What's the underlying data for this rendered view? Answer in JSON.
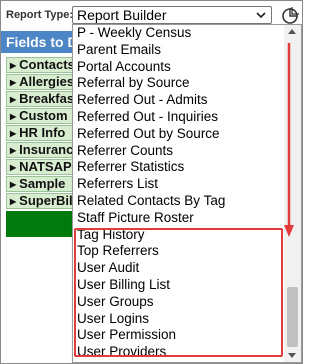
{
  "toolbar": {
    "report_type_label": "Report Type:",
    "report_type_value": "Report Builder"
  },
  "fields_header": "Fields to Display",
  "background_items": [
    "Contacts",
    "Allergies",
    "Breakfast",
    "Custom",
    "HR Info",
    "Insurance",
    "NATSAP",
    "Sample",
    "SuperBill"
  ],
  "dropdown": {
    "options": [
      "P - Weekly Census",
      "Parent Emails",
      "Portal Accounts",
      "Referral by Source",
      "Referred Out - Admits",
      "Referred Out - Inquiries",
      "Referred Out by Source",
      "Referrer Counts",
      "Referrer Statistics",
      "Referrers List",
      "Related Contacts By Tag",
      "Staff Picture Roster",
      "Tag History",
      "Top Referrers",
      "User Audit",
      "User Billing List",
      "User Groups",
      "User Logins",
      "User Permission",
      "User Providers"
    ]
  },
  "colors": {
    "header_blue": "#4d86c6",
    "item_green_bg": "#d8ecd0",
    "bar_green": "#007a0c",
    "highlight_red": "#e23b3b"
  },
  "icons": {
    "chart": "pie-chart-icon",
    "select_chevron": "chevron-down-icon",
    "annotation_arrow": "arrow-down-icon"
  }
}
